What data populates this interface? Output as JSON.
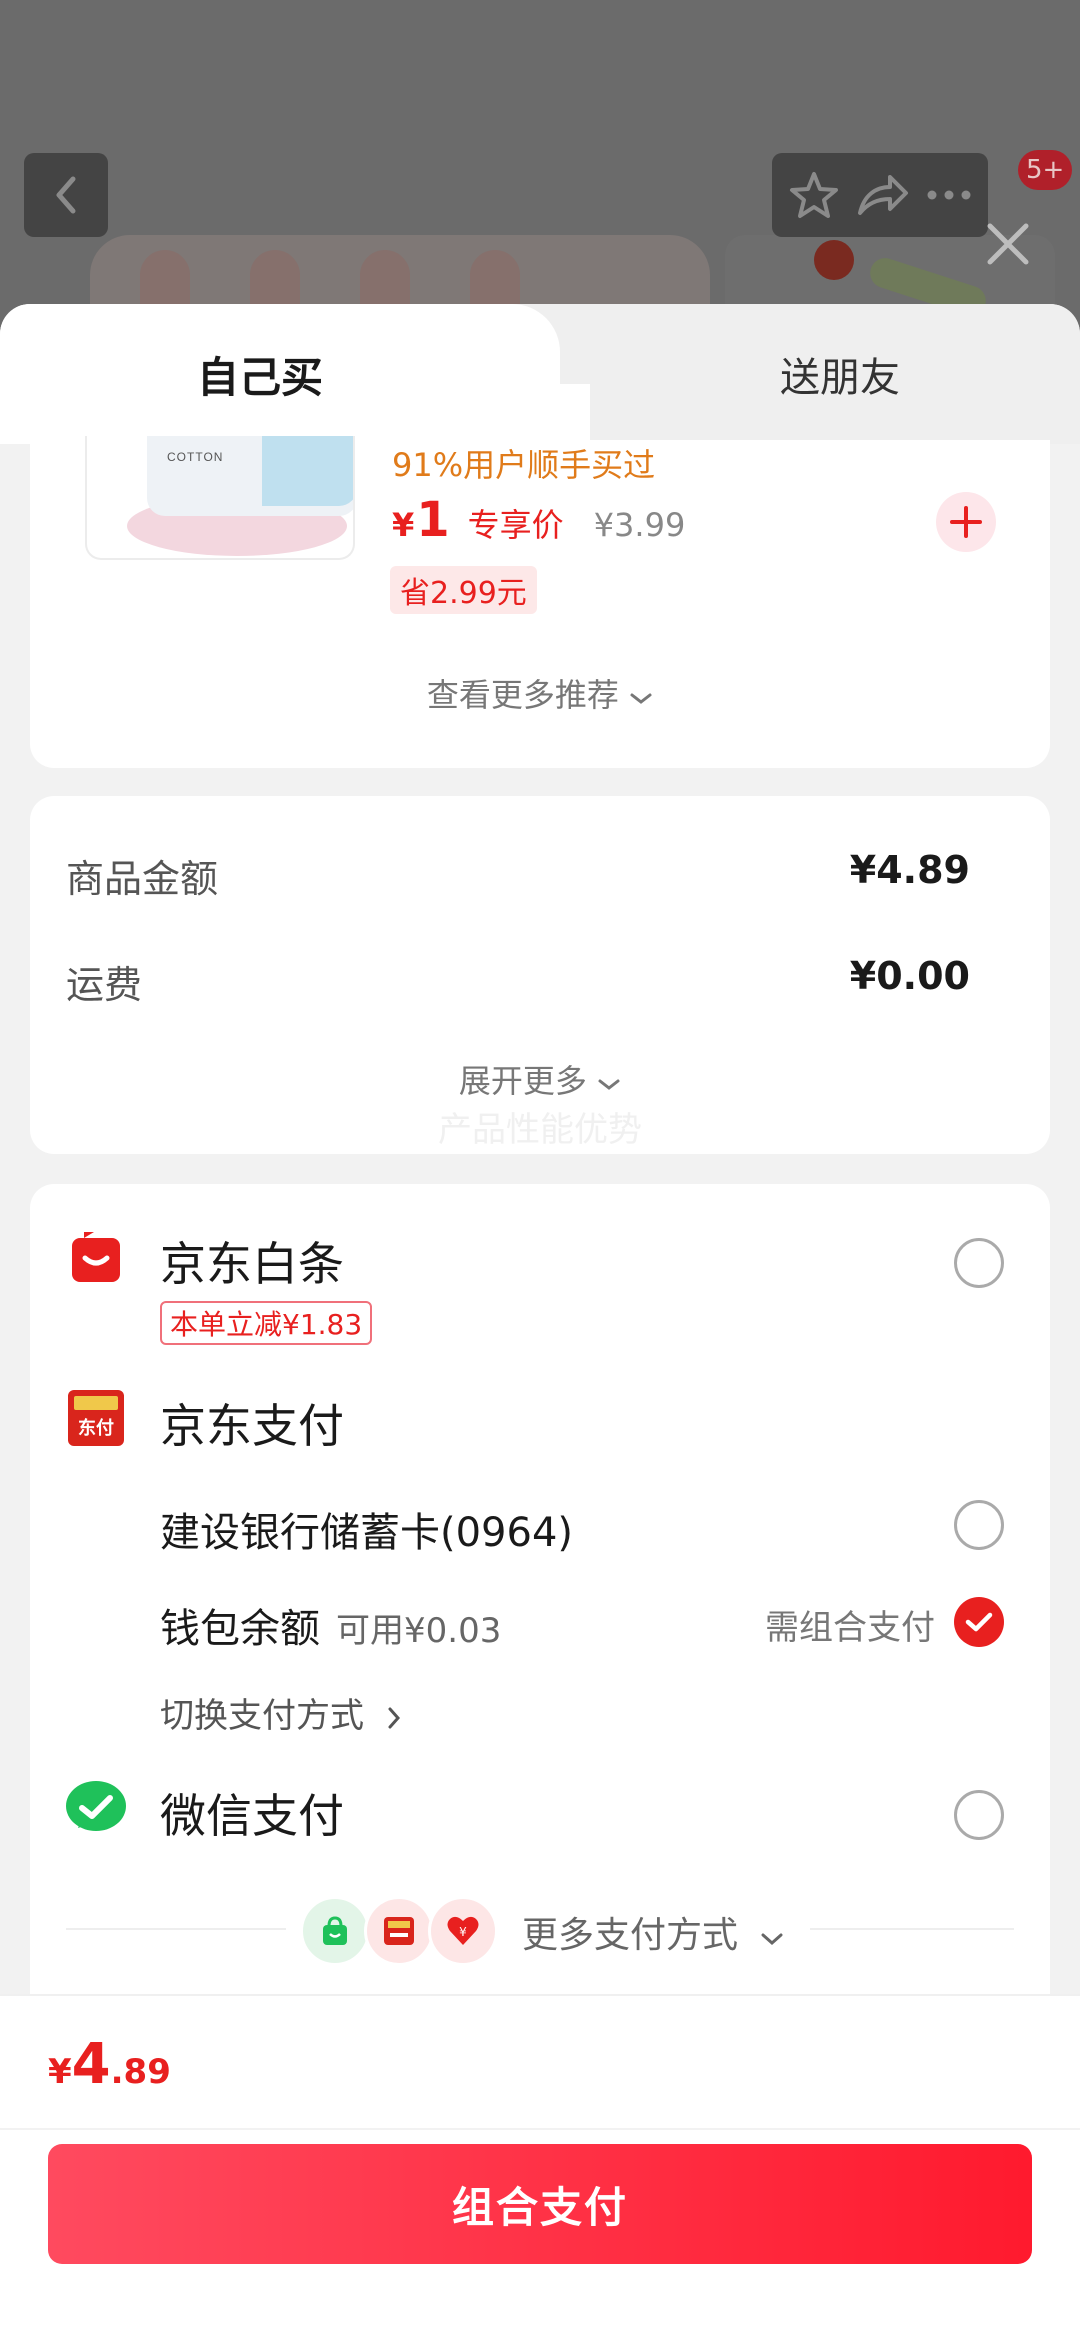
{
  "header": {
    "badge": "5+"
  },
  "tabs": {
    "self_buy": "自己买",
    "gift_friend": "送朋友"
  },
  "recommendation": {
    "product_package_text": "COTTON",
    "tag": "91%用户顺手买过",
    "price_currency": "¥",
    "price": "1",
    "price_label": "专享价",
    "original_price": "¥3.99",
    "save_text": "省2.99元",
    "see_more": "查看更多推荐"
  },
  "amount": {
    "goods_label": "商品金额",
    "goods_value": "¥4.89",
    "shipping_label": "运费",
    "shipping_value": "¥0.00",
    "expand_more": "展开更多",
    "watermark": "产品性能优势"
  },
  "payment": {
    "baitiao": {
      "name": "京东白条",
      "discount": "本单立减¥1.83",
      "selected": false
    },
    "jdpay": {
      "name": "京东支付",
      "icon_text": "东付",
      "bank_card": "建设银行储蓄卡(0964)",
      "wallet": "钱包余额",
      "wallet_available": "可用¥0.03",
      "need_combo": "需组合支付",
      "switch": "切换支付方式"
    },
    "wechat": {
      "name": "微信支付",
      "selected": false
    },
    "more_methods": "更多支付方式"
  },
  "bottom": {
    "currency": "¥",
    "total_int": "4",
    "total_dec": ".89",
    "pay_button": "组合支付"
  },
  "colors": {
    "brand_red": "#e8201f",
    "tag_orange": "#e07b1a",
    "wechat_green": "#1fc15a"
  }
}
